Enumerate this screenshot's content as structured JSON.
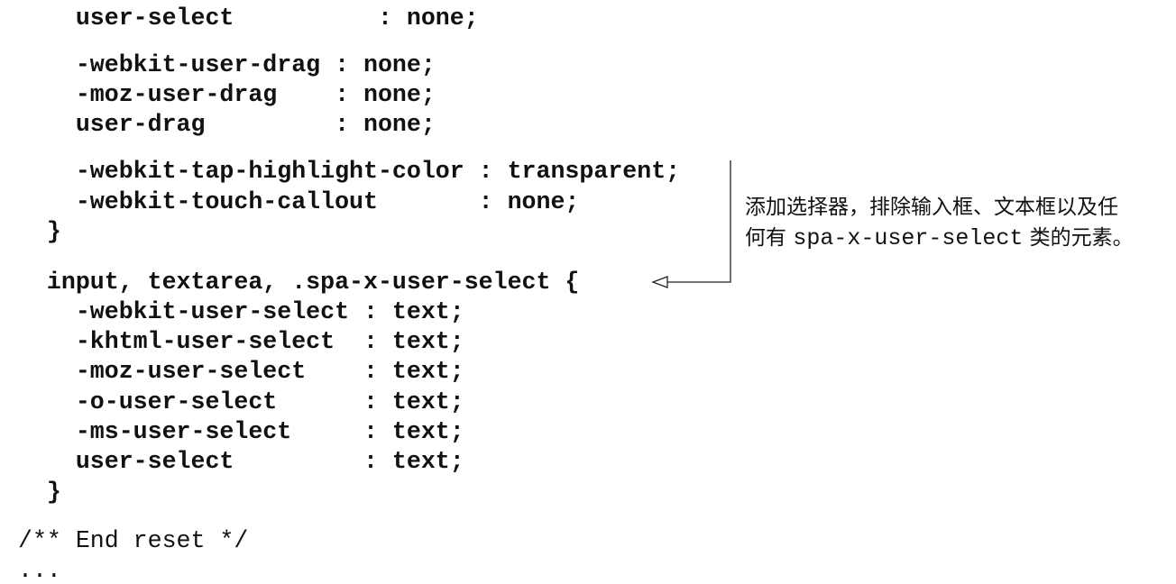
{
  "code_lines": [
    "    user-select          : none;",
    "    -webkit-user-drag : none;",
    "    -moz-user-drag    : none;",
    "    user-drag         : none;",
    "    -webkit-tap-highlight-color : transparent;",
    "    -webkit-touch-callout       : none;",
    "  }",
    "  input, textarea, .spa-x-user-select {",
    "    -webkit-user-select : text;",
    "    -khtml-user-select  : text;",
    "    -moz-user-select    : text;",
    "    -o-user-select      : text;",
    "    -ms-user-select     : text;",
    "    user-select         : text;",
    "  }",
    "/** End reset */",
    "..."
  ],
  "annotation": {
    "line1": "添加选择器，排除输入框、文本框以及任",
    "line2_prefix": "何有 ",
    "line2_code": "spa-x-user-select",
    "line2_suffix": " 类的元素。"
  }
}
